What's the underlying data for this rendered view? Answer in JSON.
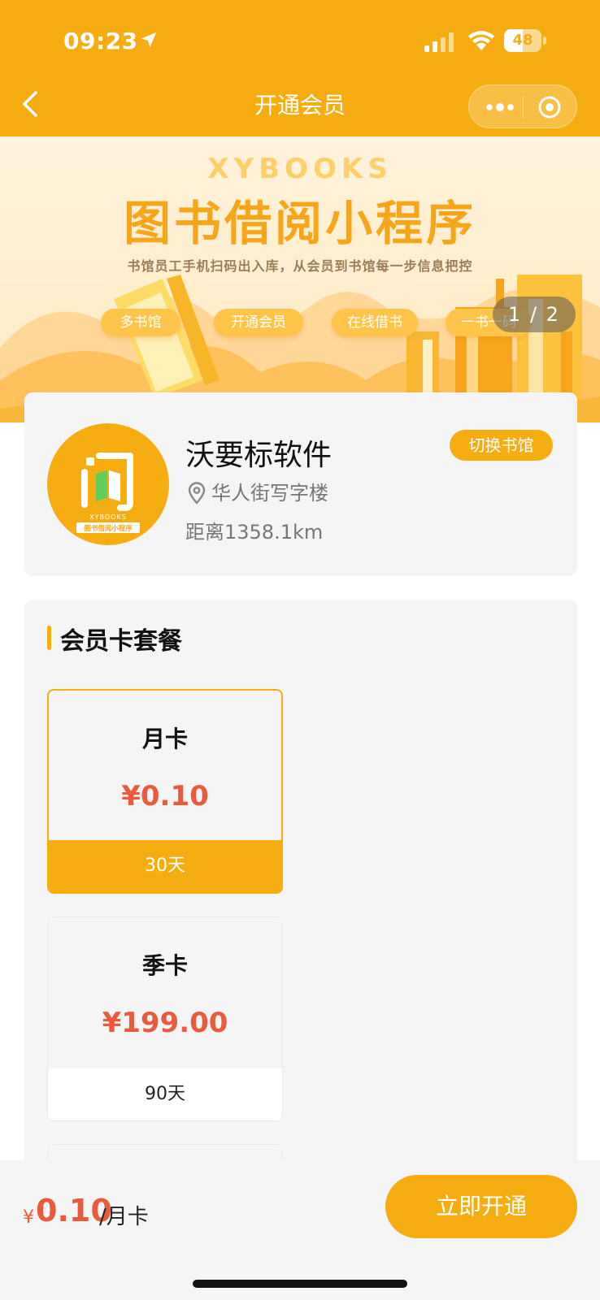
{
  "status_bar": {
    "time": "09:23",
    "battery": "48",
    "icons": [
      "location-arrow-icon",
      "signal-icon",
      "wifi-icon",
      "battery-icon"
    ]
  },
  "nav": {
    "title": "开通会员",
    "icons": [
      "back-icon",
      "more-icon",
      "close-icon"
    ]
  },
  "banner": {
    "brand": "XYBOOKS",
    "title": "图书借阅小程序",
    "subtitle": "书馆员工手机扫码出入库，从会员到书馆每一步信息把控",
    "chips": [
      "多书馆",
      "开通会员",
      "在线借书",
      "一书一码"
    ],
    "page_indicator": "1 / 2"
  },
  "library": {
    "name": "沃要标软件",
    "switch_label": "切换书馆",
    "address": "华人街写字楼",
    "distance": "距离1358.1km",
    "logo": {
      "brand": "XYBOOKS",
      "tagline": "图书借阅小程序"
    }
  },
  "packages": {
    "section_title": "会员卡套餐",
    "items": [
      {
        "name": "月卡",
        "price": "¥0.10",
        "duration": "30天",
        "selected": true
      },
      {
        "name": "季卡",
        "price": "¥199.00",
        "duration": "90天",
        "selected": false
      }
    ]
  },
  "checkout": {
    "currency": "¥",
    "price": "0.10",
    "unit": "/月卡",
    "button_label": "立即开通"
  },
  "colors": {
    "primary": "#f6ad12",
    "price": "#ea5a3c",
    "card_bg": "#f5f5f5"
  }
}
